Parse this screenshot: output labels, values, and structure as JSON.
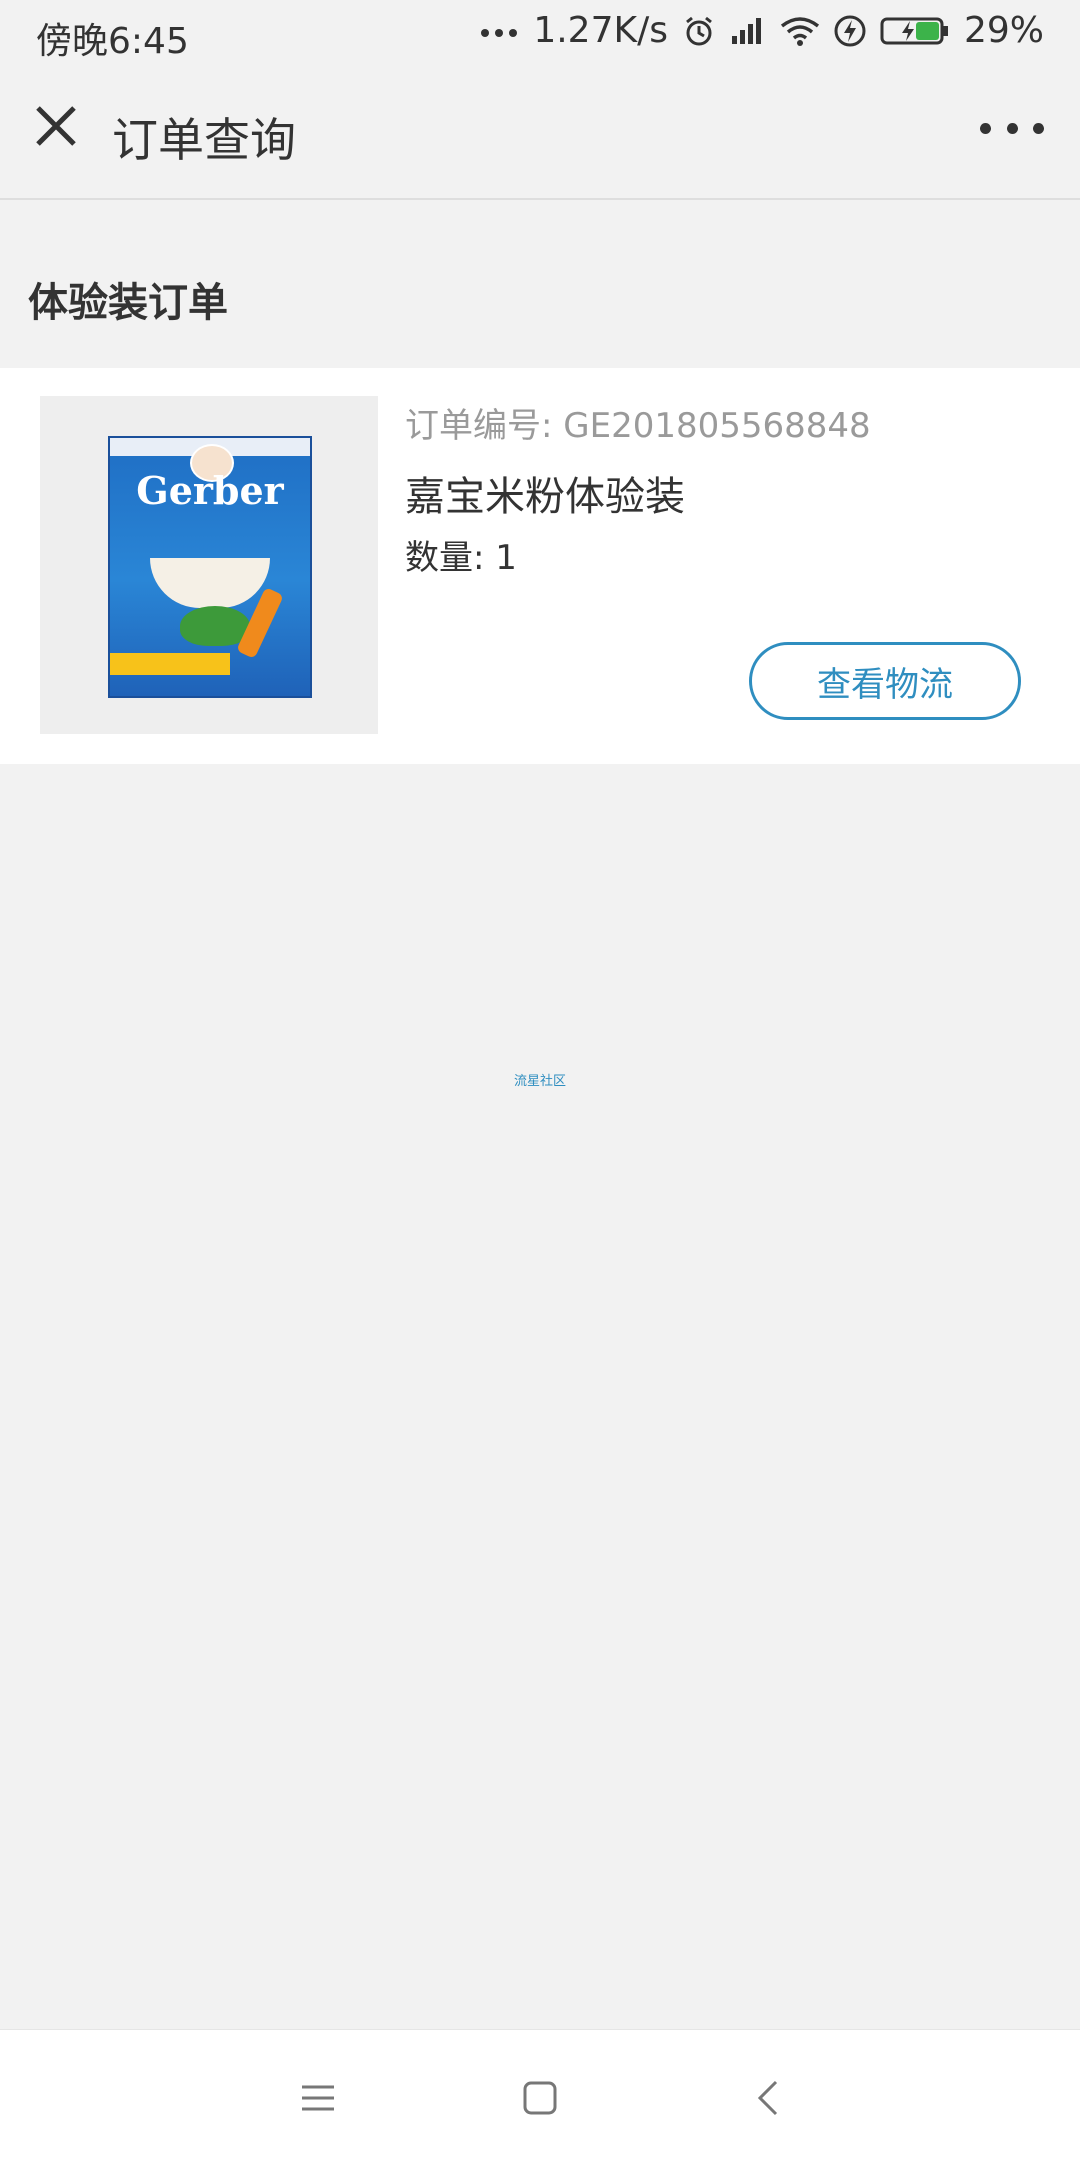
{
  "status_bar": {
    "time": "傍晚6:45",
    "network_speed": "1.27K/s",
    "battery": "29%",
    "icons": [
      "more-dots-icon",
      "alarm-icon",
      "signal-icon",
      "wifi-icon",
      "charging-icon",
      "battery-icon"
    ]
  },
  "nav": {
    "title": "订单查询",
    "close_icon": "close-icon",
    "more_icon": "more-icon"
  },
  "section": {
    "title": "体验装订单"
  },
  "order": {
    "order_number": "订单编号: GE201805568848",
    "product_name": "嘉宝米粉体验装",
    "quantity": "数量: 1",
    "action_label": "查看物流",
    "image": {
      "brand_text": "Gerber"
    }
  },
  "footer": {
    "link_text": "流星社区"
  },
  "system_nav": {
    "icons": [
      "menu-icon",
      "home-icon",
      "back-icon"
    ]
  },
  "colors": {
    "accent": "#2f8ec0",
    "background": "#f2f2f2",
    "card": "#ffffff"
  }
}
